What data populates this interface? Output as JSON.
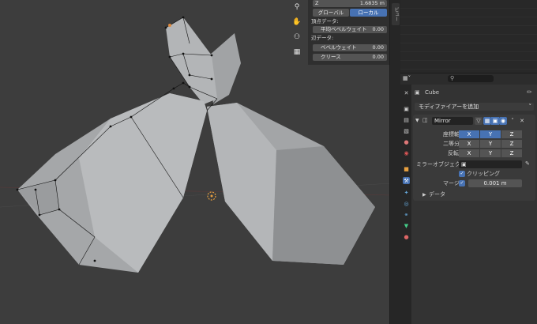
{
  "colors": {
    "accent": "#4772b3",
    "viewport_bg": "#3d3d3d",
    "panel_bg": "#333333",
    "mesh_face": "#9ea0a2"
  },
  "npanel": {
    "z_label": "Z",
    "z_value": "1.6835 m",
    "global_label": "グローバル",
    "local_label": "ローカル",
    "vertex_data_label": "頂点データ:",
    "mean_bevel_weight_label": "平均ベベルウェイト",
    "mean_bevel_weight_value": "0.00",
    "edge_data_label": "辺データ:",
    "bevel_weight_label": "ベベルウェイト",
    "bevel_weight_value": "0.00",
    "crease_label": "クリース",
    "crease_value": "0.00"
  },
  "side_tab": {
    "label": "ビュー"
  },
  "object": {
    "name": "Cube"
  },
  "modifier": {
    "add_label": "モディファイアーを追加",
    "name": "Mirror",
    "axis_label": "座標軸",
    "bisect_label": "二等分",
    "flip_label": "反転",
    "axes": [
      "X",
      "Y",
      "Z"
    ],
    "axis_active": [
      true,
      true,
      false
    ],
    "mirror_object_label": "ミラーオブジェク...",
    "clipping_label": "クリッピング",
    "clipping_checked": true,
    "merge_label": "マージ",
    "merge_checked": true,
    "merge_value": "0.001 m",
    "data_label": "データ"
  },
  "icons": [
    "magnify-icon",
    "hand-icon",
    "camera-icon",
    "grid-icon",
    "shield-icon",
    "wrench-icon",
    "pin-icon",
    "eyedropper-icon"
  ]
}
